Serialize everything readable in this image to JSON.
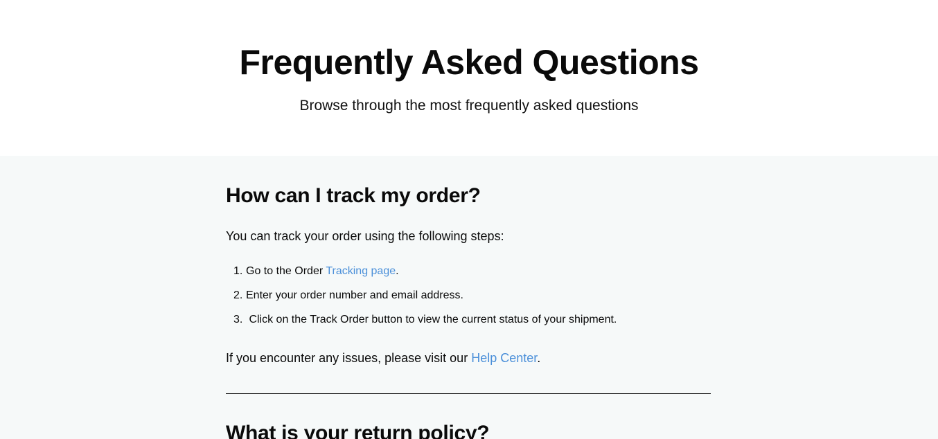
{
  "header": {
    "title": "Frequently Asked Questions",
    "subtitle": "Browse through the most frequently asked questions"
  },
  "faq": [
    {
      "question": "How can I track my order?",
      "intro": "You can track your order using the following steps:",
      "steps": [
        {
          "num": "1.",
          "text_before": "Go to the Order ",
          "link": "Tracking page",
          "text_after": "."
        },
        {
          "num": "2.",
          "text": "Enter your order number and email address."
        },
        {
          "num": "3.",
          "text": " Click on the Track Order button to view the current status of your shipment."
        }
      ],
      "outro_before": "If you encounter any issues, please visit our ",
      "outro_link": "Help Center",
      "outro_after": "."
    },
    {
      "question": "What is your return policy?"
    }
  ]
}
